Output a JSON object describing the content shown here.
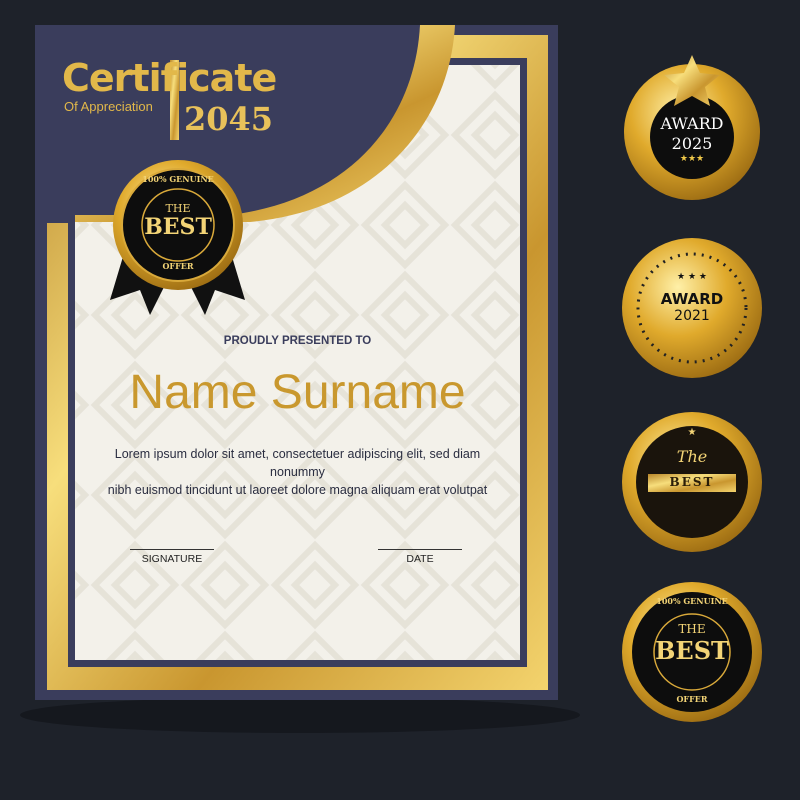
{
  "certificate": {
    "title": "Certificate",
    "subtitle": "Of Appreciation",
    "year": "2045",
    "presented_label": "PROUDLY PRESENTED TO",
    "recipient_name": "Name Surname",
    "body_line1": "Lorem ipsum dolor sit amet, consectetuer adipiscing elit, sed diam nonummy",
    "body_line2": "nibh euismod tincidunt ut laoreet dolore magna aliquam erat volutpat",
    "signature_label": "SIGNATURE",
    "date_label": "DATE",
    "seal": {
      "top": "100% GENUINE",
      "line1": "THE",
      "line2": "BEST",
      "bottom": "OFFER"
    }
  },
  "badges": [
    {
      "line1": "AWARD",
      "line2": "2025",
      "stars": "★★★"
    },
    {
      "line1": "AWARD",
      "line2": "2021",
      "stars": "★ ★ ★"
    },
    {
      "line1": "The",
      "line2": "BEST",
      "stars": "★"
    },
    {
      "top": "100% GENUINE",
      "line1": "THE",
      "line2": "BEST",
      "bottom": "OFFER"
    }
  ],
  "colors": {
    "navy": "#3a3d5c",
    "gold": "#e2b84a",
    "background": "#1e222a",
    "paper": "#f3f1ea"
  }
}
